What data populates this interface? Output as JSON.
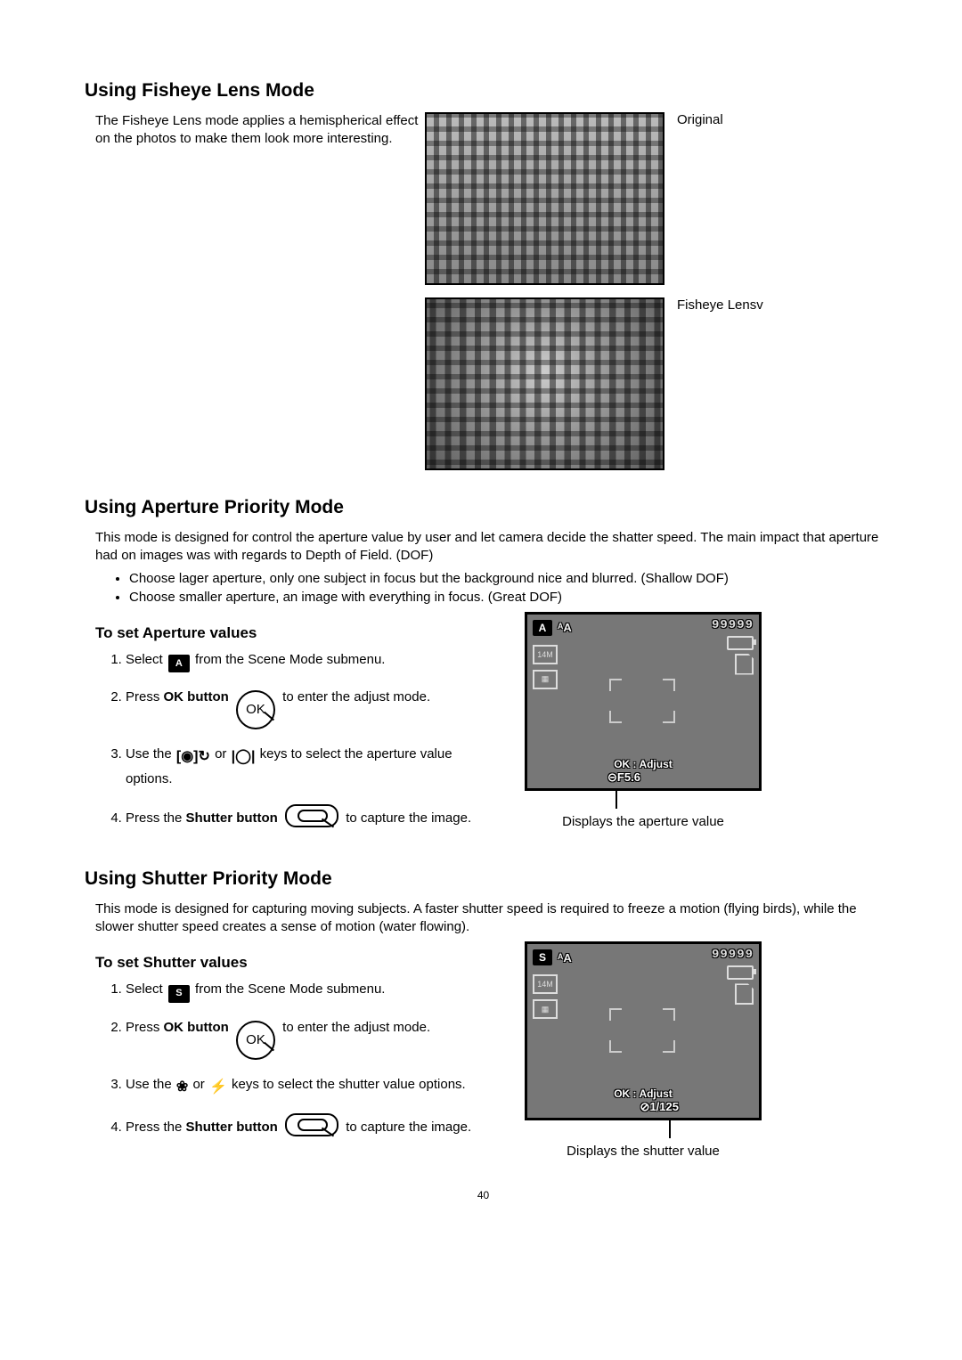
{
  "fisheye": {
    "heading": "Using Fisheye Lens Mode",
    "intro": "The Fisheye Lens mode applies a hemispherical effect on the photos to make them look more interesting.",
    "caption_original": "Original",
    "caption_fisheye": "Fisheye Lensv"
  },
  "aperture": {
    "heading": "Using Aperture Priority Mode",
    "intro": "This mode is designed for control the aperture value by user and let camera decide the shatter speed. The main impact that aperture had on images was with regards to Depth of Field. (DOF)",
    "bullets": [
      "Choose lager aperture, only one subject in focus but the background nice and blurred. (Shallow DOF)",
      "Choose smaller aperture, an image with everything in focus. (Great DOF)"
    ],
    "subheading": "To set Aperture values",
    "steps": {
      "s1a": "Select ",
      "s1b": " from the Scene Mode submenu.",
      "s2a": "Press ",
      "s2b": "OK button",
      "s2c": " to enter the adjust mode.",
      "s3a": "Use the ",
      "s3b": " or ",
      "s3c": " keys to select the aperture value options.",
      "s4a": "Press the ",
      "s4b": "Shutter button",
      "s4c": " to capture the image."
    },
    "lcd": {
      "mode_letter": "A",
      "auto_label": "ᴬA",
      "counter": "99999",
      "size_label": "14M",
      "hint": "OK : Adjust",
      "value_prefix": "⊝",
      "value": "F5.6",
      "caption": "Displays the aperture value"
    }
  },
  "shutter": {
    "heading": "Using Shutter Priority Mode",
    "intro": "This mode is designed for capturing moving subjects. A faster shutter speed is required to freeze a motion (flying birds), while the slower shutter speed creates a sense of motion (water flowing).",
    "subheading": "To set Shutter values",
    "steps": {
      "s1a": "Select ",
      "s1b": " from the Scene Mode submenu.",
      "s2a": "Press ",
      "s2b": "OK button",
      "s2c": " to enter the adjust mode.",
      "s3a": "Use the ",
      "s3b": " or ",
      "s3c": " keys to select the shutter value options.",
      "s4a": "Press the ",
      "s4b": "Shutter button",
      "s4c": " to capture the image."
    },
    "lcd": {
      "mode_letter": "S",
      "auto_label": "ᴬA",
      "counter": "99999",
      "size_label": "14M",
      "hint": "OK : Adjust",
      "value_prefix": "⊘",
      "value": "1/125",
      "caption": "Displays the shutter value"
    }
  },
  "icons": {
    "ok_text": "OK",
    "mode_a": "A",
    "mode_s": "S"
  },
  "page_number": "40"
}
